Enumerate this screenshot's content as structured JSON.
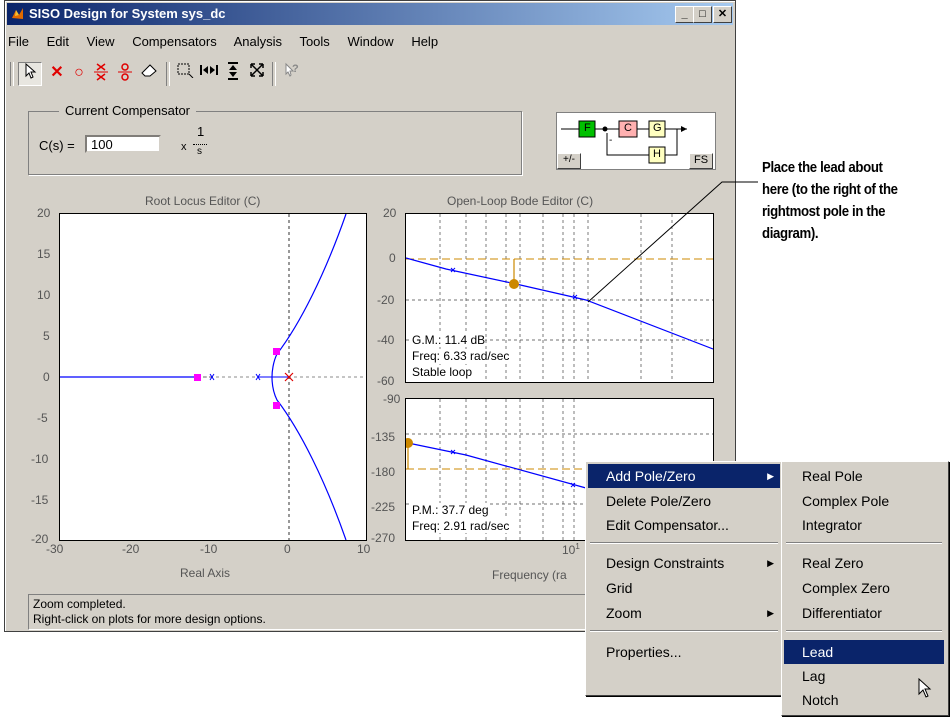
{
  "window": {
    "title": "SISO Design for System sys_dc",
    "min": "_",
    "max": "□",
    "close": "✕"
  },
  "menu": [
    "File",
    "Edit",
    "View",
    "Compensators",
    "Analysis",
    "Tools",
    "Window",
    "Help"
  ],
  "compensator": {
    "group_label": "Current Compensator",
    "lhs": "C(s) =",
    "value": "100",
    "times": "x",
    "num": "1",
    "den": "s"
  },
  "diagram": {
    "blocks": [
      "F",
      "C",
      "G",
      "H"
    ],
    "sign": "+/-",
    "fs": "FS",
    "minus": "-"
  },
  "root_locus": {
    "title": "Root Locus Editor (C)",
    "xlabel": "Real Axis",
    "xticks": [
      "-30",
      "-20",
      "-10",
      "0",
      "10"
    ],
    "yticks": [
      "20",
      "15",
      "10",
      "5",
      "0",
      "-5",
      "-10",
      "-15",
      "-20"
    ]
  },
  "bode": {
    "title": "Open-Loop Bode Editor (C)",
    "mag_ticks": [
      "20",
      "0",
      "-20",
      "-40",
      "-60"
    ],
    "phase_ticks": [
      "-90",
      "-135",
      "-180",
      "-225",
      "-270"
    ],
    "gm": "G.M.: 11.4 dB",
    "gm_freq": "Freq: 6.33 rad/sec",
    "stable": "Stable loop",
    "pm": "P.M.: 37.7 deg",
    "pm_freq": "Freq: 2.91 rad/sec",
    "xtick": "10",
    "xtick_exp": "1",
    "xlabel": "Frequency (ra"
  },
  "status": {
    "line1": "Zoom completed.",
    "line2": "Right-click on plots for more design options."
  },
  "context_menu": {
    "items": [
      "Add Pole/Zero",
      "Delete Pole/Zero",
      "Edit Compensator...",
      "Design Constraints",
      "Grid",
      "Zoom",
      "Properties..."
    ]
  },
  "submenu": {
    "items": [
      "Real Pole",
      "Complex Pole",
      "Integrator",
      "Real Zero",
      "Complex Zero",
      "Differentiator",
      "Lead",
      "Lag",
      "Notch"
    ],
    "selected": "Lead"
  },
  "callout": {
    "lines": [
      "Place the lead about",
      "here (to the right of the",
      "rightmost pole in the",
      "diagram)."
    ]
  },
  "colors": {
    "title_start": "#0a246a",
    "title_end": "#a6caf0",
    "locus": "#0000ff",
    "pole": "#ff00ff",
    "margin": "#cc8800"
  }
}
